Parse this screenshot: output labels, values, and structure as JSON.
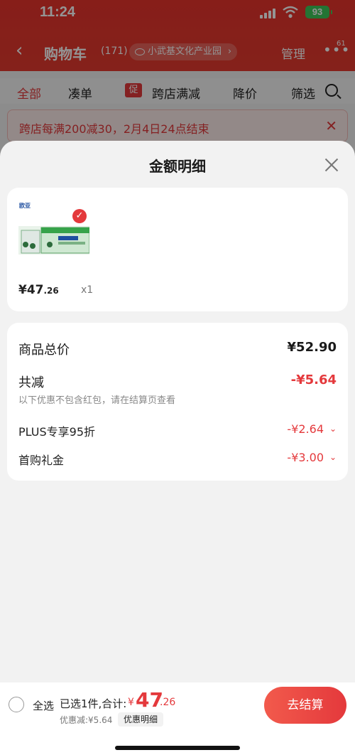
{
  "status_bar": {
    "time": "11:24",
    "battery": "93"
  },
  "nav": {
    "back": "‹",
    "title": "购物车",
    "count": "(171)",
    "location": "小武基文化产业园",
    "manage": "管理",
    "more": "•••",
    "badge": "61"
  },
  "filters": [
    {
      "label": "全部",
      "active": true
    },
    {
      "label": "凑单"
    },
    {
      "label": "跨店满减",
      "tag": "促"
    },
    {
      "label": "降价"
    },
    {
      "label": "筛选"
    }
  ],
  "promo_banner": {
    "text": "跨店每满200减30，2月4日24点结束"
  },
  "sheet": {
    "title": "金额明细",
    "product": {
      "price_int": "¥47",
      "price_dec": ".26",
      "qty": "x1",
      "image": "milk-product-image",
      "check": "✓"
    },
    "summary": {
      "total_label": "商品总价",
      "total_value": "¥52.90",
      "reduce_label": "共减",
      "reduce_value": "-¥5.64",
      "note": "以下优惠不包含红包，请在结算页查看",
      "items": [
        {
          "label": "PLUS专享95折",
          "value": "-¥2.64"
        },
        {
          "label": "首购礼金",
          "value": "-¥3.00"
        }
      ]
    }
  },
  "bottom": {
    "select_all": "全选",
    "selected": "已选1件,合计:",
    "currency": "¥",
    "total_int": "47",
    "total_dec": ".26",
    "discount": "优惠减:¥5.64",
    "detail": "优惠明细",
    "checkout": "去结算"
  }
}
